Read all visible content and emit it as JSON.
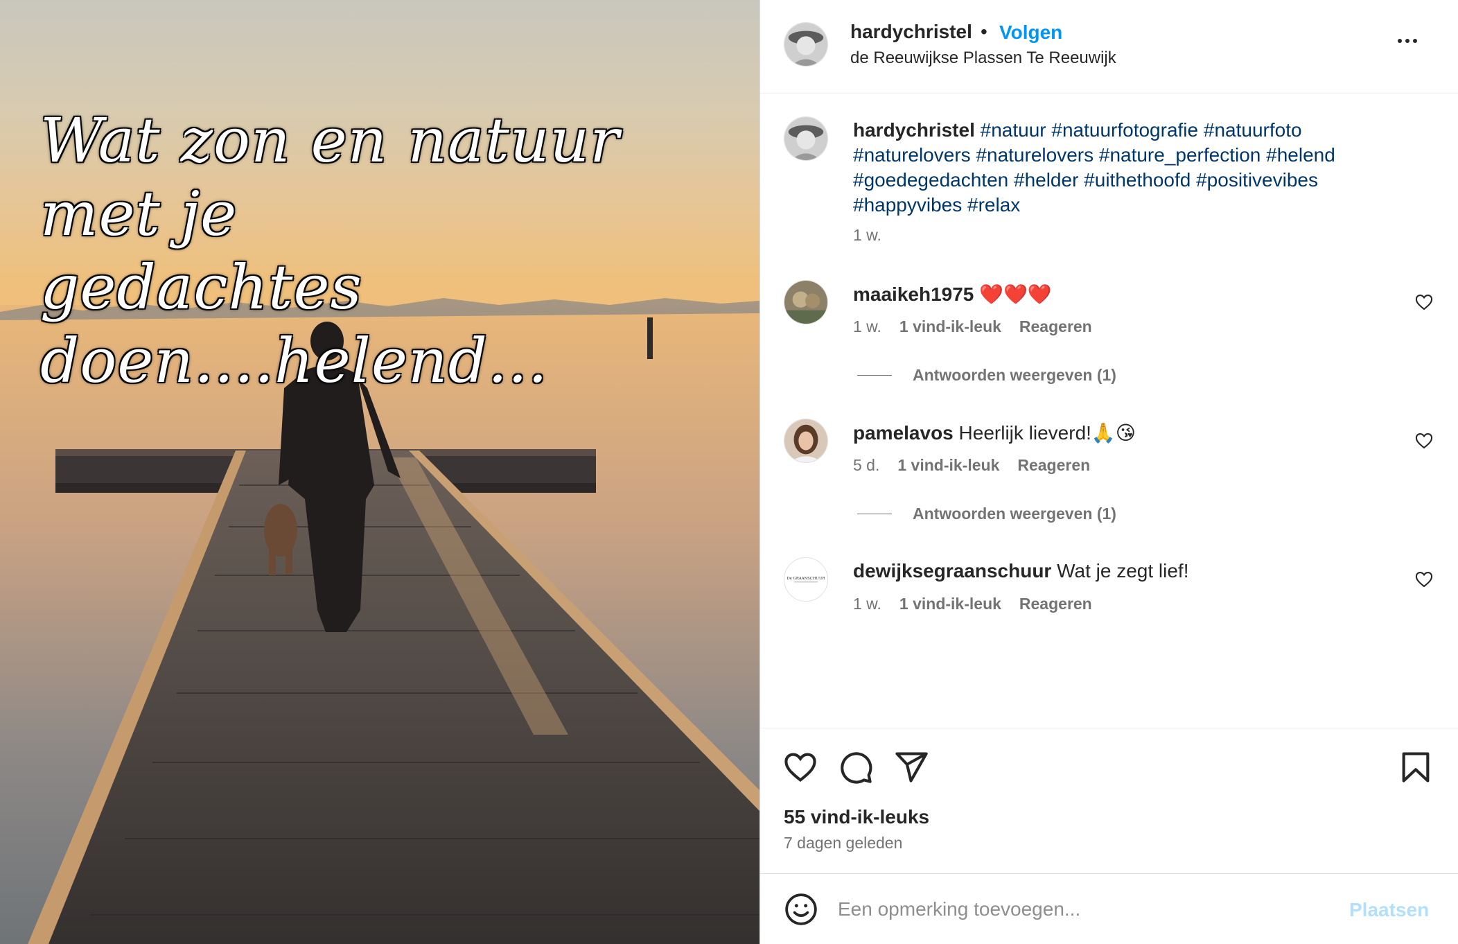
{
  "post": {
    "overlay_line1": "Wat zon en natuur met je",
    "overlay_line2": "gedachtes doen....helend..."
  },
  "header": {
    "username": "hardychristel",
    "separator": "•",
    "follow_label": "Volgen",
    "location": "de Reeuwijkse Plassen Te Reeuwijk",
    "more_icon": "more-horizontal-icon"
  },
  "caption": {
    "username": "hardychristel",
    "hashtags": "#natuur #natuurfotografie #natuurfoto #naturelovers #naturelovers #nature_perfection #helend #goedegedachten #helder #uithethoofd #positivevibes #happyvibes #relax",
    "time": "1 w."
  },
  "comments": [
    {
      "username": "maaikeh1975",
      "text": "❤️❤️❤️",
      "time": "1 w.",
      "likes": "1 vind-ik-leuk",
      "reply": "Reageren",
      "view_replies": "Antwoorden weergeven (1)"
    },
    {
      "username": "pamelavos",
      "text": "Heerlijk lieverd!🙏😘",
      "time": "5 d.",
      "likes": "1 vind-ik-leuk",
      "reply": "Reageren",
      "view_replies": "Antwoorden weergeven (1)"
    },
    {
      "username": "dewijksegraanschuur",
      "text": "Wat je zegt lief!",
      "time": "1 w.",
      "likes": "1 vind-ik-leuk",
      "reply": "Reageren",
      "avatar_text": "De GRAANSCHUUR"
    }
  ],
  "actions": {
    "like_icon": "heart-icon",
    "comment_icon": "comment-icon",
    "share_icon": "send-icon",
    "save_icon": "bookmark-icon",
    "likes_count": "55 vind-ik-leuks",
    "date": "7 dagen geleden"
  },
  "add_comment": {
    "emoji_icon": "smiley-icon",
    "placeholder": "Een opmerking toevoegen...",
    "post_label": "Plaatsen"
  },
  "colors": {
    "accent": "#0095f6",
    "hashtag": "#00376b",
    "muted": "#737373",
    "post_disabled": "#b2dffc"
  }
}
